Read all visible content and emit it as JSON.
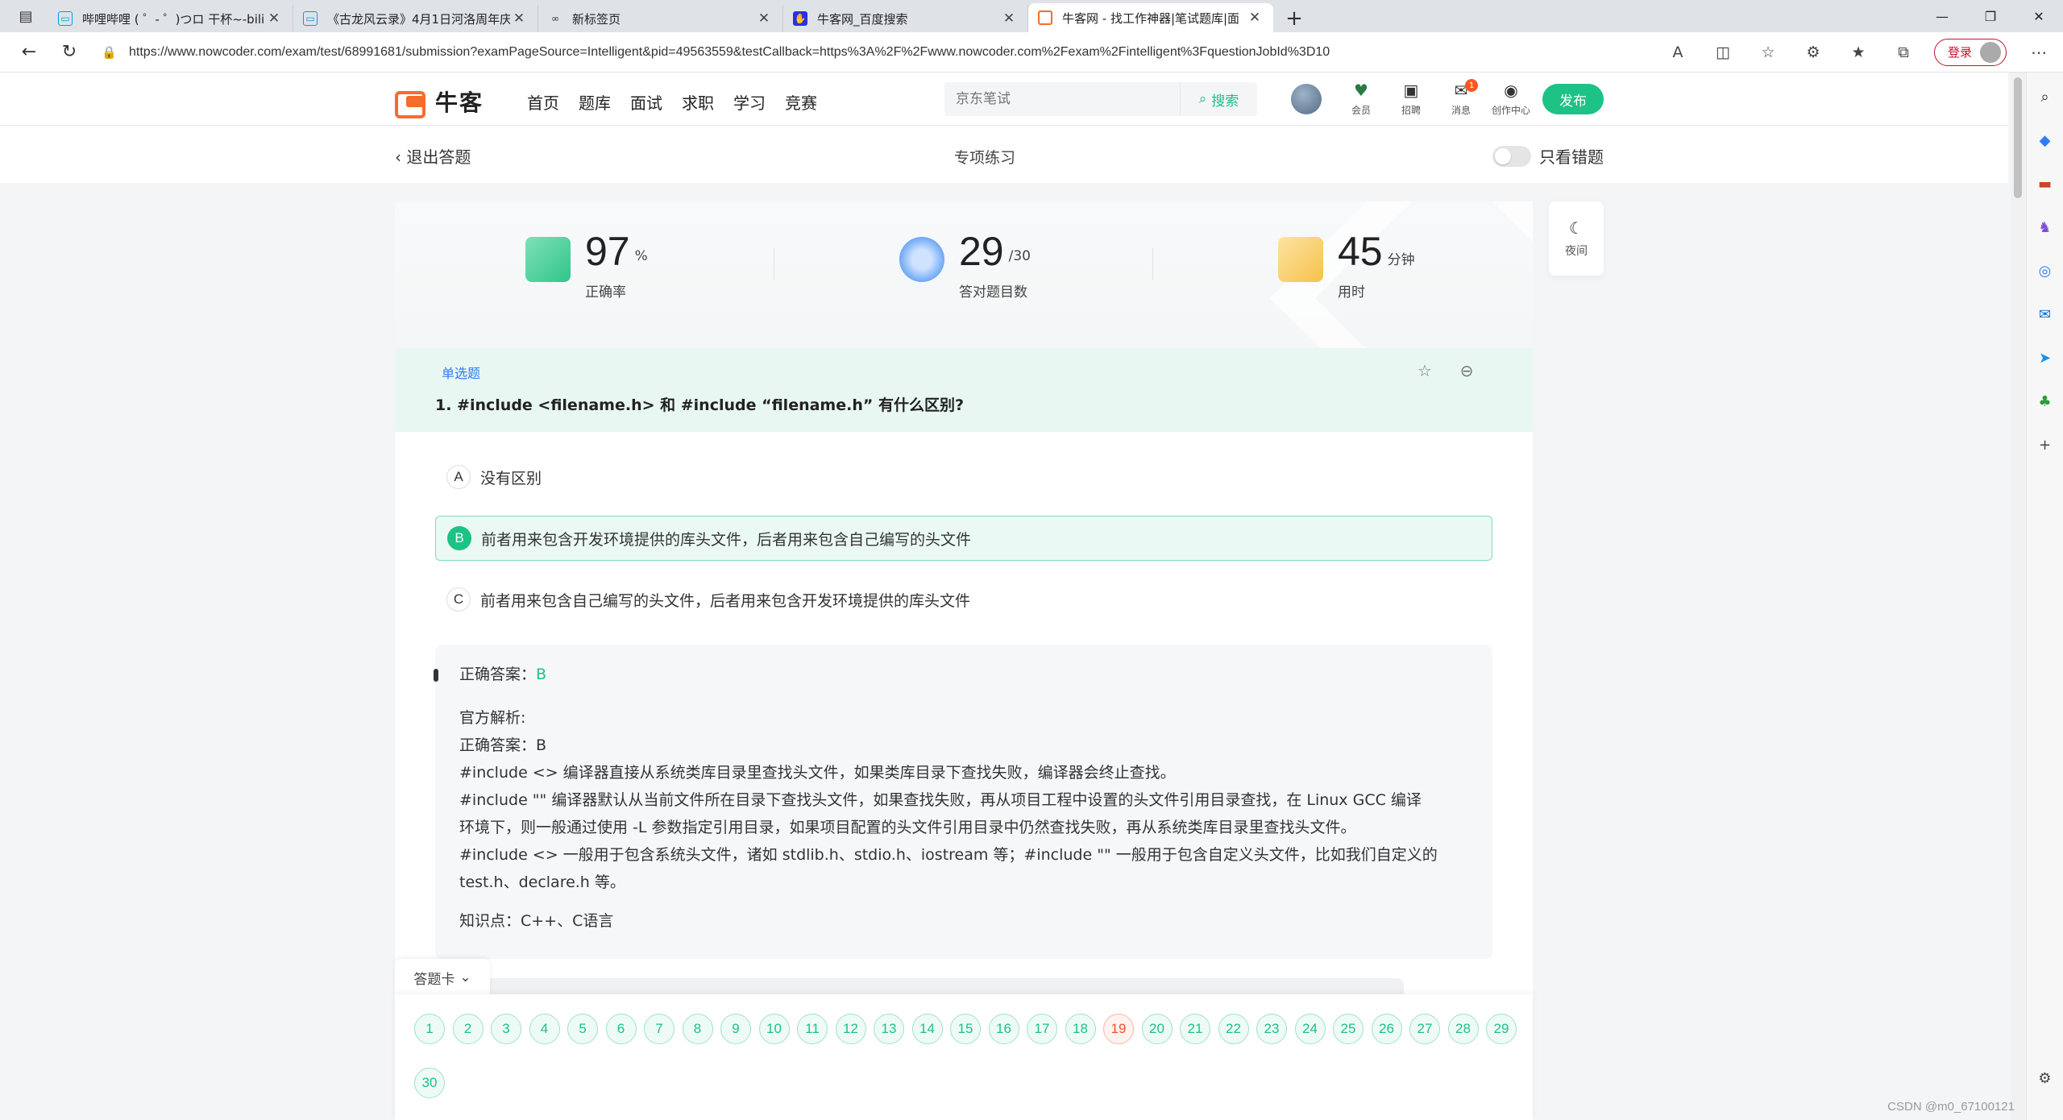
{
  "browser": {
    "tabs": [
      {
        "title": "哔哩哔哩 ( ゜- ゜)つロ 干杯~-bilib",
        "icon": "bilibili-icon",
        "active": false
      },
      {
        "title": "《古龙风云录》4月1日河洛周年庆",
        "icon": "bilibili-icon",
        "active": false
      },
      {
        "title": "新标签页",
        "icon": "newtab-icon",
        "active": false
      },
      {
        "title": "牛客网_百度搜索",
        "icon": "baidu-icon",
        "active": false
      },
      {
        "title": "牛客网 - 找工作神器|笔试题库|面",
        "icon": "nowcoder-icon",
        "active": true
      }
    ],
    "url": "https://www.nowcoder.com/exam/test/68991681/submission?examPageSource=Intelligent&pid=49563559&testCallback=https%3A%2F%2Fwww.nowcoder.com%2Fexam%2Fintelligent%3FquestionJobId%3D10",
    "login_label": "登录"
  },
  "site": {
    "logo_text": "牛客",
    "nav": [
      "首页",
      "题库",
      "面试",
      "求职",
      "学习",
      "竞赛"
    ],
    "search_placeholder": "京东笔试",
    "search_button": "搜索",
    "header_icons": [
      {
        "label": "会员",
        "icon": "vip-icon",
        "glyph": "♥"
      },
      {
        "label": "招聘",
        "icon": "recruit-icon",
        "glyph": "▣"
      },
      {
        "label": "消息",
        "icon": "message-icon",
        "glyph": "✉",
        "badge": "1"
      },
      {
        "label": "创作中心",
        "icon": "creator-icon",
        "glyph": "◉"
      }
    ],
    "publish": "发布"
  },
  "subheader": {
    "back": "退出答题",
    "title": "专项练习",
    "toggle_label": "只看错题"
  },
  "stats": {
    "accuracy": {
      "value": "97",
      "unit": "%",
      "caption": "正确率"
    },
    "correct": {
      "value": "29",
      "unit": "/30",
      "caption": "答对题目数"
    },
    "time": {
      "value": "45",
      "unit": "分钟",
      "caption": "用时"
    }
  },
  "question": {
    "type": "单选题",
    "text": "1. #include <filename.h> 和 #include “filename.h” 有什么区别?",
    "options": [
      {
        "letter": "A",
        "text": "没有区别",
        "selected": false
      },
      {
        "letter": "B",
        "text": "前者用来包含开发环境提供的库头文件，后者用来包含自己编写的头文件",
        "selected": true
      },
      {
        "letter": "C",
        "text": "前者用来包含自己编写的头文件，后者用来包含开发环境提供的库头文件",
        "selected": false
      }
    ]
  },
  "analysis": {
    "correct_label": "正确答案：",
    "correct_value": "B",
    "official_title": "官方解析:",
    "line1": "正确答案：B",
    "line2": "#include <> 编译器直接从系统类库目录里查找头文件，如果类库目录下查找失败，编译器会终止查找。",
    "line3": "#include \"\" 编译器默认从当前文件所在目录下查找头文件，如果查找失败，再从项目工程中设置的头文件引用目录查找，在 Linux GCC 编译",
    "line4": "环境下，则一般通过使用 -L 参数指定引用目录，如果项目配置的头文件引用目录中仍然查找失败，再从系统类库目录里查找头文件。",
    "line5": "#include <> 一般用于包含系统头文件，诸如 stdlib.h、stdio.h、iostream 等；#include \"\" 一般用于包含自定义头文件，比如我们自定义的",
    "line6": "test.h、declare.h 等。",
    "knowledge": "知识点：C++、C语言"
  },
  "answer_card": {
    "label": "答题卡",
    "numbers": [
      "1",
      "2",
      "3",
      "4",
      "5",
      "6",
      "7",
      "8",
      "9",
      "10",
      "11",
      "12",
      "13",
      "14",
      "15",
      "16",
      "17",
      "18",
      "19",
      "20",
      "21",
      "22",
      "23",
      "24",
      "25",
      "26",
      "27",
      "28",
      "29",
      "30"
    ],
    "wrong": "19"
  },
  "night": "夜间",
  "watermark": "CSDN @m0_67100121",
  "colors": {
    "brand": "#1dc285",
    "wrong": "#f04f2e",
    "link": "#2f7cf6",
    "logo": "#f56c2b"
  }
}
